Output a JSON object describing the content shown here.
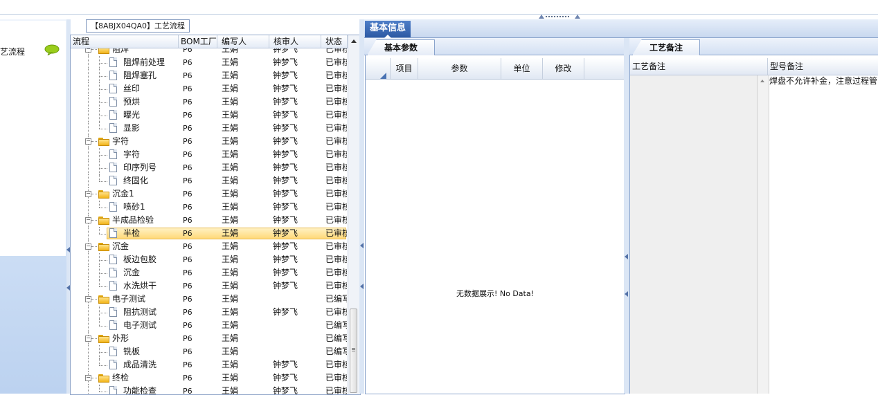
{
  "left_nav": {
    "label": "工艺流程",
    "icon": "speech-bubble-icon"
  },
  "tree": {
    "title": "【8ABJX04QA0】工艺流程",
    "columns": [
      "流程",
      "BOM工厂",
      "编写人",
      "核审人",
      "状态"
    ],
    "rows": [
      {
        "level": 1,
        "type": "folder",
        "name": "阻焊",
        "bom": "P6",
        "writer": "王娟",
        "reviewer": "钟梦飞",
        "status": "已审核"
      },
      {
        "level": 2,
        "type": "doc",
        "name": "阻焊前处理",
        "bom": "P6",
        "writer": "王娟",
        "reviewer": "钟梦飞",
        "status": "已审核"
      },
      {
        "level": 2,
        "type": "doc",
        "name": "阻焊塞孔",
        "bom": "P6",
        "writer": "王娟",
        "reviewer": "钟梦飞",
        "status": "已审核"
      },
      {
        "level": 2,
        "type": "doc",
        "name": "丝印",
        "bom": "P6",
        "writer": "王娟",
        "reviewer": "钟梦飞",
        "status": "已审核"
      },
      {
        "level": 2,
        "type": "doc",
        "name": "预烘",
        "bom": "P6",
        "writer": "王娟",
        "reviewer": "钟梦飞",
        "status": "已审核"
      },
      {
        "level": 2,
        "type": "doc",
        "name": "曝光",
        "bom": "P6",
        "writer": "王娟",
        "reviewer": "钟梦飞",
        "status": "已审核"
      },
      {
        "level": 2,
        "type": "doc",
        "name": "显影",
        "bom": "P6",
        "writer": "王娟",
        "reviewer": "钟梦飞",
        "status": "已审核"
      },
      {
        "level": 1,
        "type": "folder",
        "name": "字符",
        "bom": "P6",
        "writer": "王娟",
        "reviewer": "钟梦飞",
        "status": "已审核"
      },
      {
        "level": 2,
        "type": "doc",
        "name": "字符",
        "bom": "P6",
        "writer": "王娟",
        "reviewer": "钟梦飞",
        "status": "已审核"
      },
      {
        "level": 2,
        "type": "doc",
        "name": "印序列号",
        "bom": "P6",
        "writer": "王娟",
        "reviewer": "钟梦飞",
        "status": "已审核"
      },
      {
        "level": 2,
        "type": "doc",
        "name": "终固化",
        "bom": "P6",
        "writer": "王娟",
        "reviewer": "钟梦飞",
        "status": "已审核"
      },
      {
        "level": 1,
        "type": "folder",
        "name": "沉金1",
        "bom": "P6",
        "writer": "王娟",
        "reviewer": "钟梦飞",
        "status": "已审核"
      },
      {
        "level": 2,
        "type": "doc",
        "name": "喷砂1",
        "bom": "P6",
        "writer": "王娟",
        "reviewer": "钟梦飞",
        "status": "已审核"
      },
      {
        "level": 1,
        "type": "folder",
        "name": "半成品检验",
        "bom": "P6",
        "writer": "王娟",
        "reviewer": "钟梦飞",
        "status": "已审核"
      },
      {
        "level": 2,
        "type": "doc",
        "name": "半检",
        "bom": "P6",
        "writer": "王娟",
        "reviewer": "钟梦飞",
        "status": "已审核",
        "selected": true
      },
      {
        "level": 1,
        "type": "folder",
        "name": "沉金",
        "bom": "P6",
        "writer": "王娟",
        "reviewer": "钟梦飞",
        "status": "已审核"
      },
      {
        "level": 2,
        "type": "doc",
        "name": "板边包胶",
        "bom": "P6",
        "writer": "王娟",
        "reviewer": "钟梦飞",
        "status": "已审核"
      },
      {
        "level": 2,
        "type": "doc",
        "name": "沉金",
        "bom": "P6",
        "writer": "王娟",
        "reviewer": "钟梦飞",
        "status": "已审核"
      },
      {
        "level": 2,
        "type": "doc",
        "name": "水洗烘干",
        "bom": "P6",
        "writer": "王娟",
        "reviewer": "钟梦飞",
        "status": "已审核"
      },
      {
        "level": 1,
        "type": "folder",
        "name": "电子测试",
        "bom": "P6",
        "writer": "王娟",
        "reviewer": "",
        "status": "已编写"
      },
      {
        "level": 2,
        "type": "doc",
        "name": "阻抗测试",
        "bom": "P6",
        "writer": "王娟",
        "reviewer": "钟梦飞",
        "status": "已审核"
      },
      {
        "level": 2,
        "type": "doc",
        "name": "电子测试",
        "bom": "P6",
        "writer": "王娟",
        "reviewer": "",
        "status": "已编写"
      },
      {
        "level": 1,
        "type": "folder",
        "name": "外形",
        "bom": "P6",
        "writer": "王娟",
        "reviewer": "",
        "status": "已编写"
      },
      {
        "level": 2,
        "type": "doc",
        "name": "铣板",
        "bom": "P6",
        "writer": "王娟",
        "reviewer": "",
        "status": "已编写"
      },
      {
        "level": 2,
        "type": "doc",
        "name": "成品清洗",
        "bom": "P6",
        "writer": "王娟",
        "reviewer": "钟梦飞",
        "status": "已审核"
      },
      {
        "level": 1,
        "type": "folder",
        "name": "终检",
        "bom": "P6",
        "writer": "王娟",
        "reviewer": "钟梦飞",
        "status": "已审核"
      },
      {
        "level": 2,
        "type": "doc",
        "name": "功能检查",
        "bom": "P6",
        "writer": "王娟",
        "reviewer": "钟梦飞",
        "status": "已审核"
      }
    ]
  },
  "basic_info_tab": "基本信息",
  "params": {
    "tab": "基本参数",
    "columns": [
      "项目",
      "参数",
      "单位",
      "修改"
    ],
    "empty_text": "无数据展示! No Data!"
  },
  "notes": {
    "tab": "工艺备注",
    "columns": [
      "工艺备注",
      "型号备注"
    ],
    "model_note": "焊盘不允许补金，注意过程管"
  }
}
